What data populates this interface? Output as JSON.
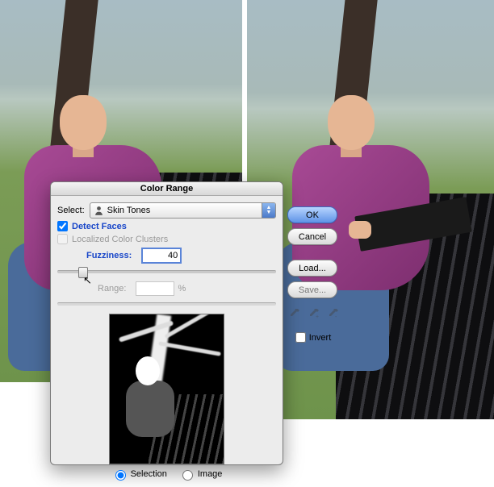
{
  "dialog": {
    "title": "Color Range",
    "select_label": "Select:",
    "select_value": "Skin Tones",
    "detect_faces": "Detect Faces",
    "localized_clusters": "Localized Color Clusters",
    "fuzziness_label": "Fuzziness:",
    "fuzziness_value": "40",
    "range_label": "Range:",
    "range_value": "",
    "range_unit": "%",
    "radios": {
      "selection": "Selection",
      "image": "Image"
    },
    "buttons": {
      "ok": "OK",
      "cancel": "Cancel",
      "load": "Load...",
      "save": "Save..."
    },
    "invert": "Invert"
  },
  "icons": {
    "person": "person-icon",
    "dropper": "eyedropper-icon",
    "dropper_plus": "eyedropper-plus-icon",
    "dropper_minus": "eyedropper-minus-icon"
  }
}
